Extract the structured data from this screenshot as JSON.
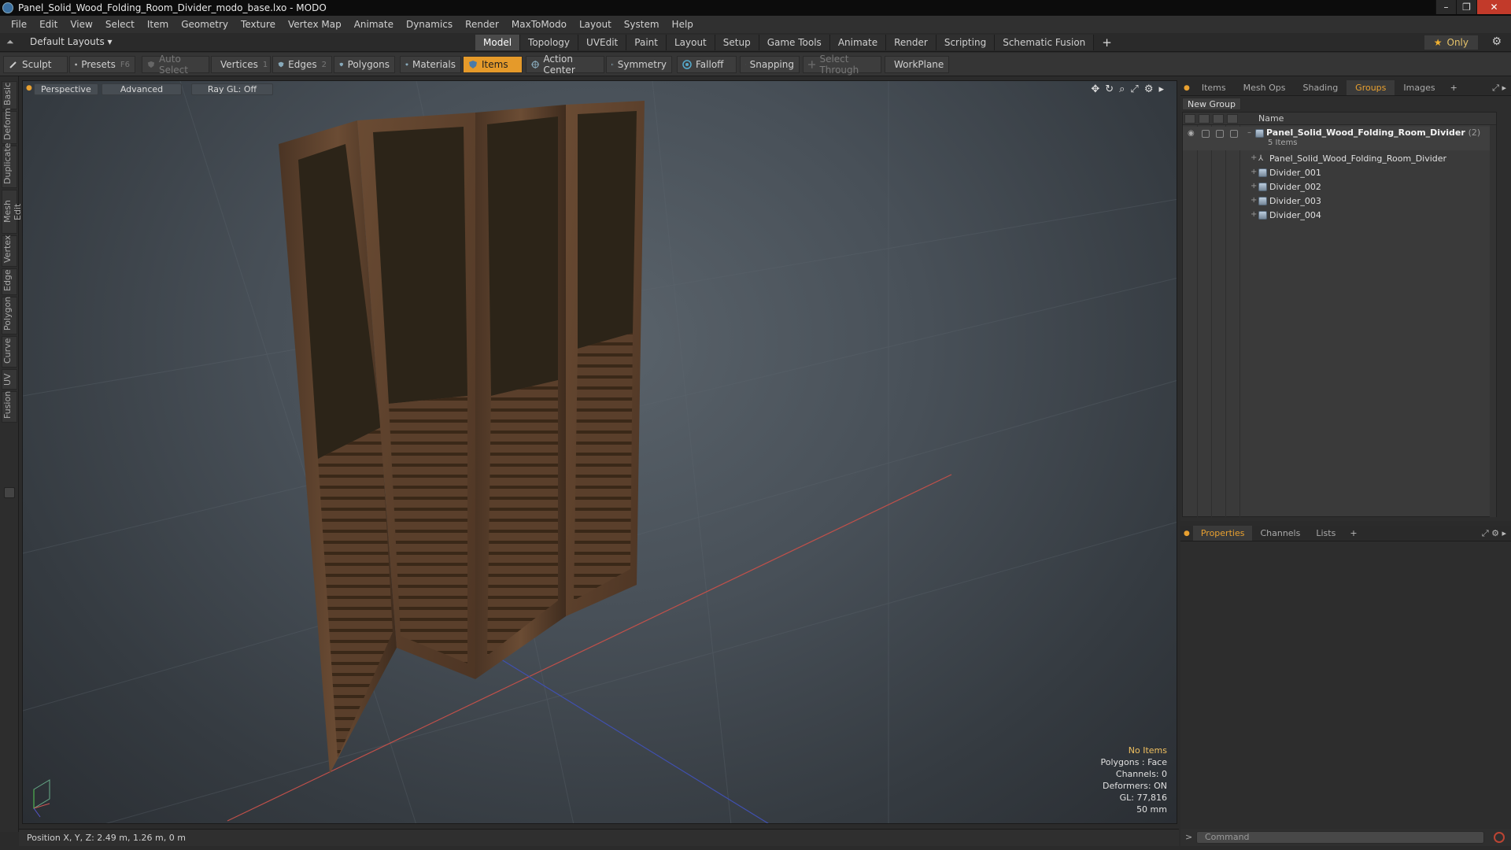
{
  "window": {
    "title": "Panel_Solid_Wood_Folding_Room_Divider_modo_base.lxo - MODO",
    "controls": [
      "–",
      "❐",
      "✕"
    ]
  },
  "menu": [
    "File",
    "Edit",
    "View",
    "Select",
    "Item",
    "Geometry",
    "Texture",
    "Vertex Map",
    "Animate",
    "Dynamics",
    "Render",
    "MaxToModo",
    "Layout",
    "System",
    "Help"
  ],
  "layoutbar": {
    "default_layouts": "Default Layouts ▾",
    "tabs": [
      "Model",
      "Topology",
      "UVEdit",
      "Paint",
      "Layout",
      "Setup",
      "Game Tools",
      "Animate",
      "Render",
      "Scripting",
      "Schematic Fusion"
    ],
    "active_tab": "Model",
    "plus": "+",
    "only_label": "Only",
    "star": "★"
  },
  "toolbar": {
    "sculpt": "Sculpt",
    "presets": "Presets",
    "presets_key": "F6",
    "auto_select": "Auto Select",
    "vertices": "Vertices",
    "vertices_count": "1",
    "edges": "Edges",
    "edges_count": "2",
    "polygons": "Polygons",
    "materials": "Materials",
    "items": "Items",
    "action_center": "Action Center",
    "symmetry": "Symmetry",
    "falloff": "Falloff",
    "snapping": "Snapping",
    "select_through": "Select Through",
    "workplane": "WorkPlane"
  },
  "lefttabs": [
    "Basic",
    "Deform",
    "Duplicate",
    "Mesh Edit",
    "Vertex",
    "Edge",
    "Polygon",
    "Curve",
    "UV",
    "Fusion"
  ],
  "viewport": {
    "perspective": "Perspective",
    "advanced": "Advanced",
    "raygl": "Ray GL: Off",
    "info": {
      "no_items": "No Items",
      "polygons": "Polygons : Face",
      "channels": "Channels: 0",
      "deformers": "Deformers: ON",
      "gl": "GL: 77,816",
      "scale": "50 mm"
    }
  },
  "status": {
    "position": "Position X, Y, Z:  2.49 m, 1.26 m, 0 m"
  },
  "rightpanel": {
    "tabs": [
      "Items",
      "Mesh Ops",
      "Shading",
      "Groups",
      "Images"
    ],
    "active_tab": "Groups",
    "new_group": "New Group",
    "name_header": "Name",
    "group": {
      "name": "Panel_Solid_Wood_Folding_Room_Divider",
      "count": "(2)",
      "items_label": "5 Items"
    },
    "items": [
      "Panel_Solid_Wood_Folding_Room_Divider",
      "Divider_001",
      "Divider_002",
      "Divider_003",
      "Divider_004"
    ]
  },
  "proppanel": {
    "tabs": [
      "Properties",
      "Channels",
      "Lists"
    ],
    "active_tab": "Properties"
  },
  "command": {
    "placeholder": "Command"
  },
  "colors": {
    "accent": "#e59a2a",
    "active_tab_text": "#e8a030",
    "info_highlight": "#f0c060"
  }
}
